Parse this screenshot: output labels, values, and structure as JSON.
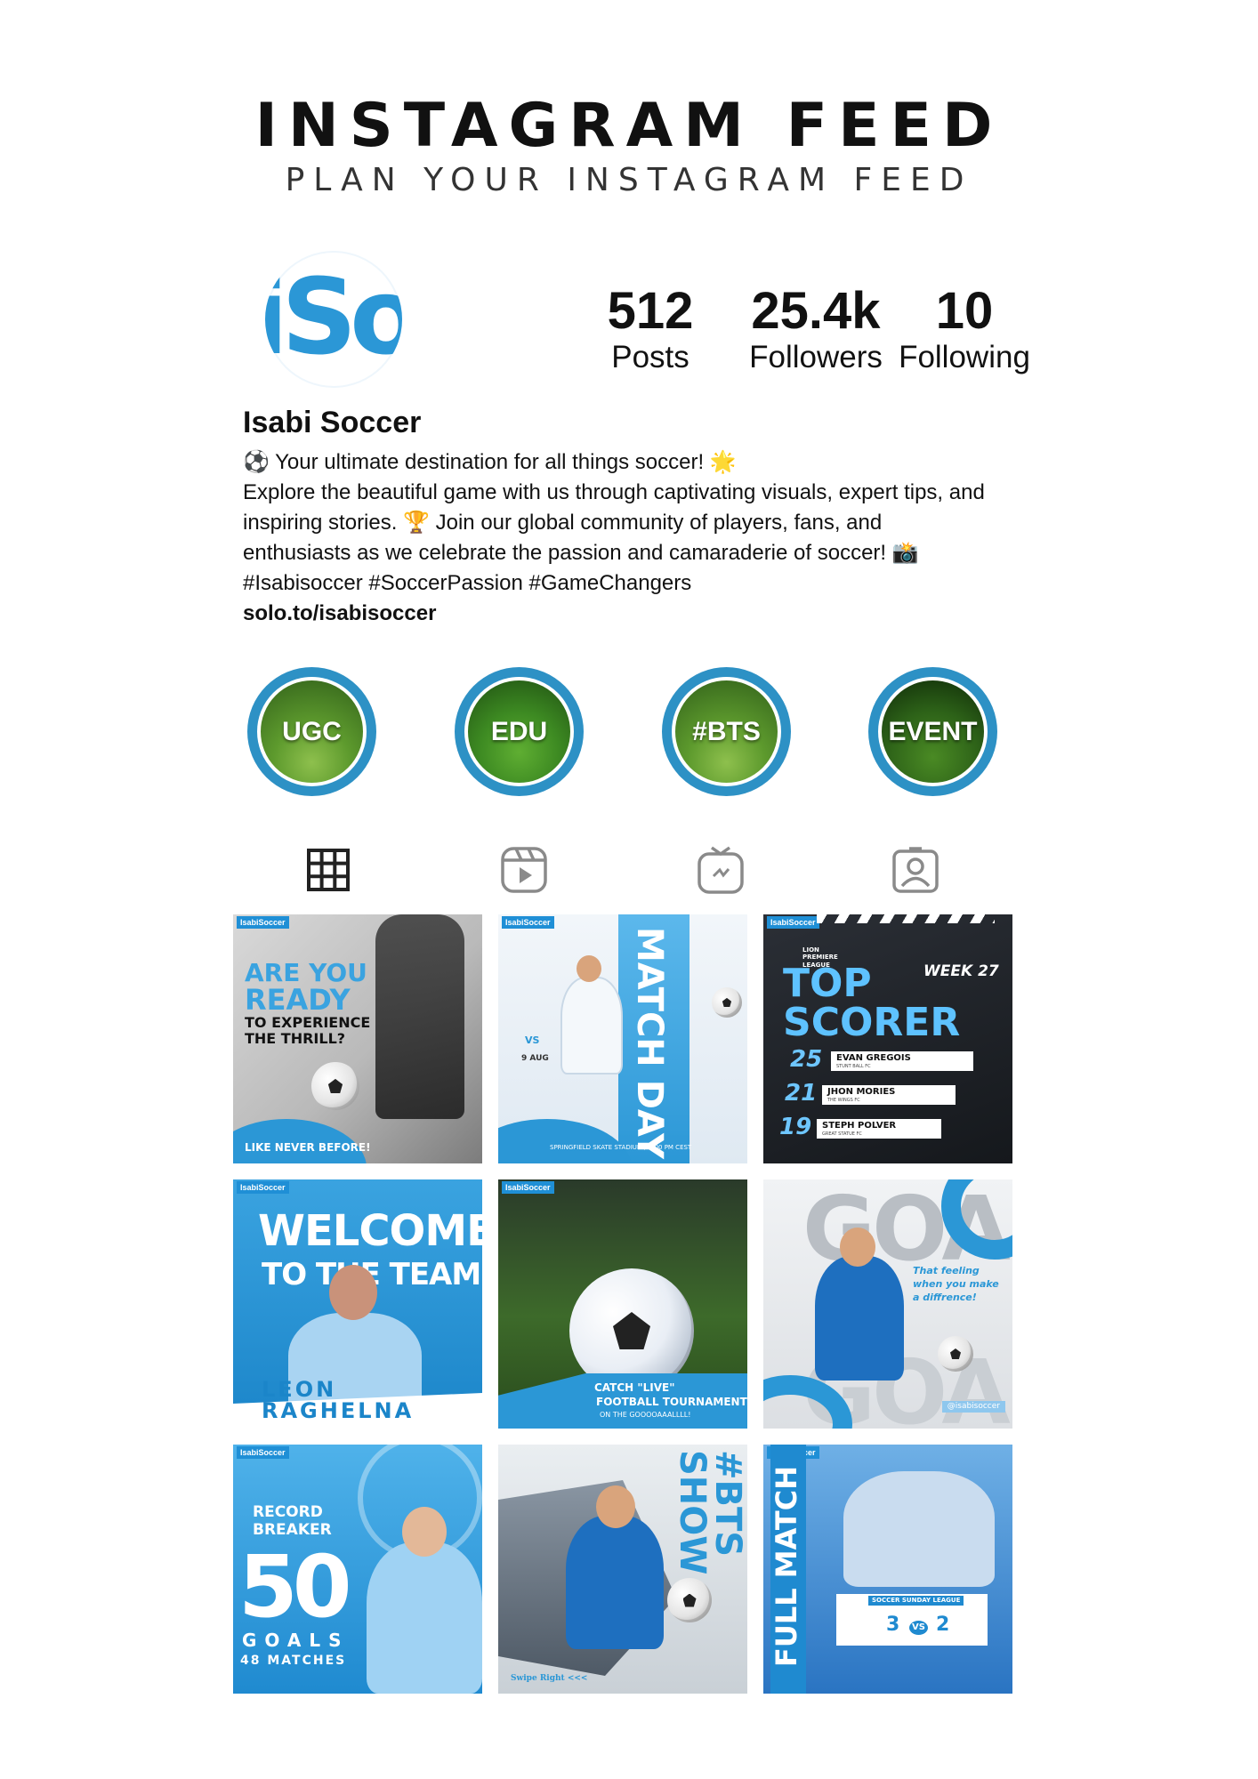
{
  "header": {
    "title": "INSTAGRAM FEED",
    "subtitle": "PLAN YOUR INSTAGRAM FEED"
  },
  "profile": {
    "avatar_text": "iSo",
    "name": "Isabi Soccer",
    "stats": [
      {
        "value": "512",
        "label": "Posts"
      },
      {
        "value": "25.4k",
        "label": "Followers"
      },
      {
        "value": "10",
        "label": "Following"
      }
    ],
    "bio": [
      "⚽ Your ultimate destination for all things soccer! 🌟",
      "Explore the beautiful game with us through captivating visuals, expert tips, and",
      "inspiring stories. 🏆 Join our global community of players, fans, and",
      "enthusiasts as we celebrate the passion and camaraderie of soccer! 📸",
      "#Isabisoccer #SoccerPassion #GameChangers"
    ],
    "link": "solo.to/isabisoccer"
  },
  "highlights": [
    {
      "label": "UGC"
    },
    {
      "label": "EDU"
    },
    {
      "label": "#BTS"
    },
    {
      "label": "EVENT"
    }
  ],
  "tabs": [
    {
      "icon": "grid-icon"
    },
    {
      "icon": "reels-icon"
    },
    {
      "icon": "igtv-icon"
    },
    {
      "icon": "tagged-icon"
    }
  ],
  "posts": {
    "brand": "IsabiSoccer",
    "p1": {
      "line1": "ARE YOU",
      "line2": "READY",
      "line3": "TO EXPERIENCE",
      "line4": "THE THRILL?",
      "footer": "LIKE NEVER BEFORE!"
    },
    "p2": {
      "title": "MATCH DAY",
      "vs": "VS",
      "date": "9 AUG",
      "venue": "SPRINGFIELD SKATE STADIUM / 8:00 PM CEST"
    },
    "p3": {
      "league": "LION PREMIERE LEAGUE",
      "week": "WEEK 27",
      "title1": "TOP",
      "title2": "SCORER",
      "rows": [
        {
          "goals": "25",
          "name": "EVAN GREGOIS",
          "team": "STUNT BALL FC"
        },
        {
          "goals": "21",
          "name": "JHON MORIES",
          "team": "THE WINGS FC"
        },
        {
          "goals": "19",
          "name": "STEPH POLVER",
          "team": "GREAT STATUE FC"
        }
      ]
    },
    "p4": {
      "line1": "WELCOME",
      "line2": "TO THE TEAM",
      "player": "LEON RAGHELNA"
    },
    "p5": {
      "line1": "CATCH \"LIVE\"",
      "line2": "FOOTBALL TOURNAMENT",
      "line3": "ON THE GOOOOAAALLLL!"
    },
    "p6": {
      "bg": "GOAL",
      "caption": "That feeling when you make a diffrence!",
      "handle": "@isabisoccer"
    },
    "p7": {
      "line1": "RECORD",
      "line2": "BREAKER",
      "number": "50",
      "line3": "GOALS",
      "line4": "48 MATCHES"
    },
    "p8": {
      "title": "#BTS SHOW",
      "swipe": "Swipe Right <<<"
    },
    "p9": {
      "title": "FULL MATCH",
      "league": "SOCCER SUNDAY LEAGUE",
      "home": "3",
      "vs": "VS",
      "away": "2"
    }
  },
  "colors": {
    "accent": "#2b97d6",
    "highlight_ring": "#2d91c5",
    "text": "#111111"
  }
}
